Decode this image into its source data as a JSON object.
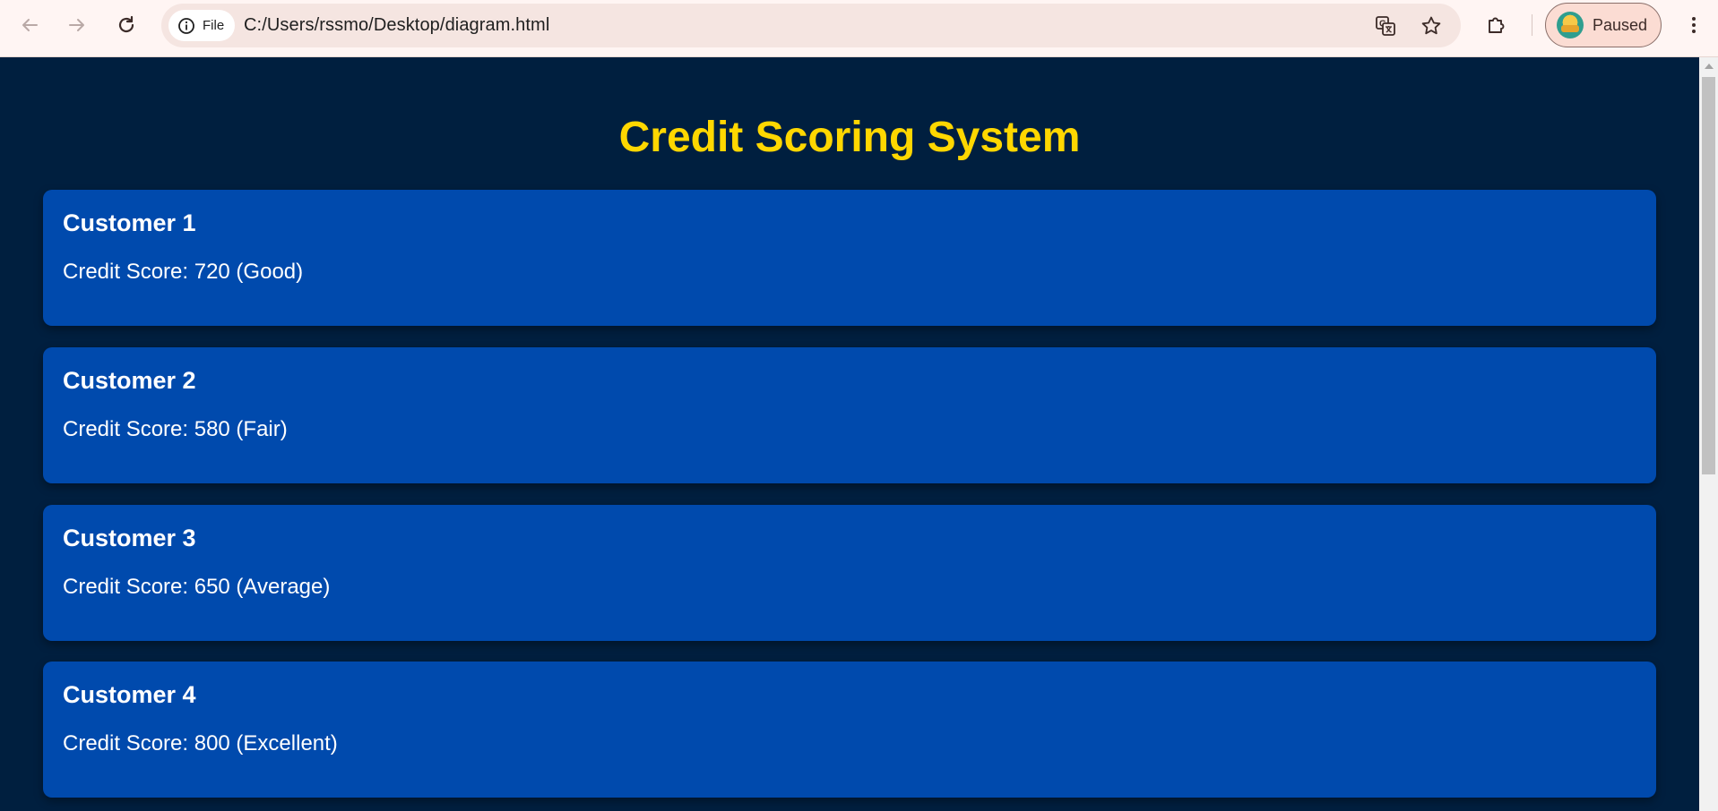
{
  "browser": {
    "site_chip_label": "File",
    "url": "C:/Users/rssmo/Desktop/diagram.html",
    "profile_label": "Paused"
  },
  "page": {
    "title": "Credit Scoring System"
  },
  "customers": [
    {
      "name": "Customer 1",
      "score_text": "Credit Score: 720 (Good)"
    },
    {
      "name": "Customer 2",
      "score_text": "Credit Score: 580 (Fair)"
    },
    {
      "name": "Customer 3",
      "score_text": "Credit Score: 650 (Average)"
    },
    {
      "name": "Customer 4",
      "score_text": "Credit Score: 800 (Excellent)"
    }
  ],
  "colors": {
    "page_background": "#001f3f",
    "title": "#ffd700",
    "card_background": "#004aad",
    "card_text": "#ffffff"
  }
}
